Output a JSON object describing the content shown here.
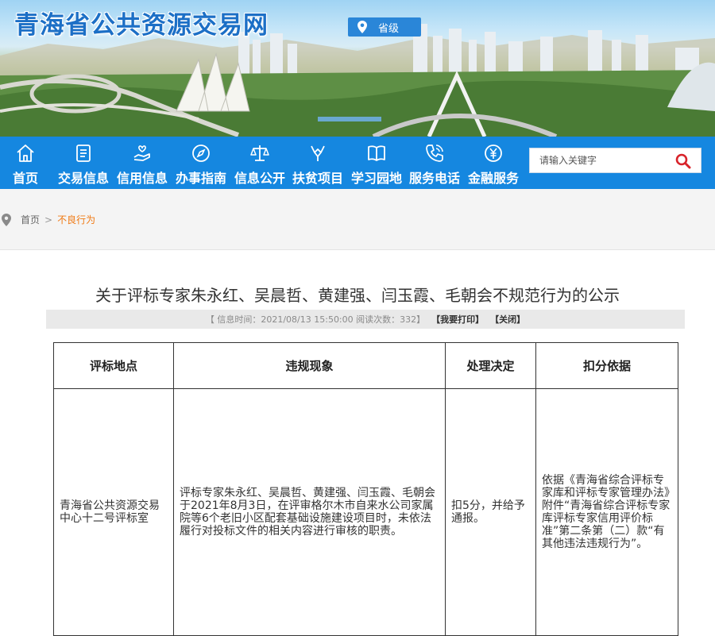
{
  "site": {
    "title": "青海省公共资源交易网",
    "region": "省级"
  },
  "nav": {
    "items": [
      {
        "label": "首页",
        "icon": "home-icon"
      },
      {
        "label": "交易信息",
        "icon": "document-icon"
      },
      {
        "label": "信用信息",
        "icon": "hand-heart-icon"
      },
      {
        "label": "办事指南",
        "icon": "compass-icon"
      },
      {
        "label": "信息公开",
        "icon": "scales-icon"
      },
      {
        "label": "扶贫项目",
        "icon": "support-icon"
      },
      {
        "label": "学习园地",
        "icon": "book-icon"
      },
      {
        "label": "服务电话",
        "icon": "phone-icon"
      },
      {
        "label": "金融服务",
        "icon": "yuan-icon"
      }
    ]
  },
  "search": {
    "placeholder": "请输入关键字"
  },
  "breadcrumb": {
    "home": "首页",
    "separator": ">",
    "current": "不良行为"
  },
  "article": {
    "title": "关于评标专家朱永红、吴晨哲、黄建强、闫玉霞、毛朝会不规范行为的公示",
    "meta": "【 信息时间：2021/08/13 15:50:00  阅读次数：332】",
    "print_label": "【我要打印】",
    "close_label": "【关闭】"
  },
  "table": {
    "headers": [
      "评标地点",
      "违规现象",
      "处理决定",
      "扣分依据"
    ],
    "row": {
      "location": "青海省公共资源交易中心十二号评标室",
      "violation": "评标专家朱永红、吴晨哲、黄建强、闫玉霞、毛朝会于2021年8月3日，在评审格尔木市自来水公司家属院等6个老旧小区配套基础设施建设项目时，未依法履行对投标文件的相关内容进行审核的职责。",
      "decision": "扣5分，并给予通报。",
      "basis": "依据《青海省综合评标专家库和评标专家管理办法》附件“青海省综合评标专家库评标专家信用评价标准”第二条第（二）款“有其他违法违规行为”。"
    }
  },
  "colors": {
    "nav": "#1587e0",
    "title": "#1c6fc6",
    "crumb_current": "#f07a14"
  }
}
